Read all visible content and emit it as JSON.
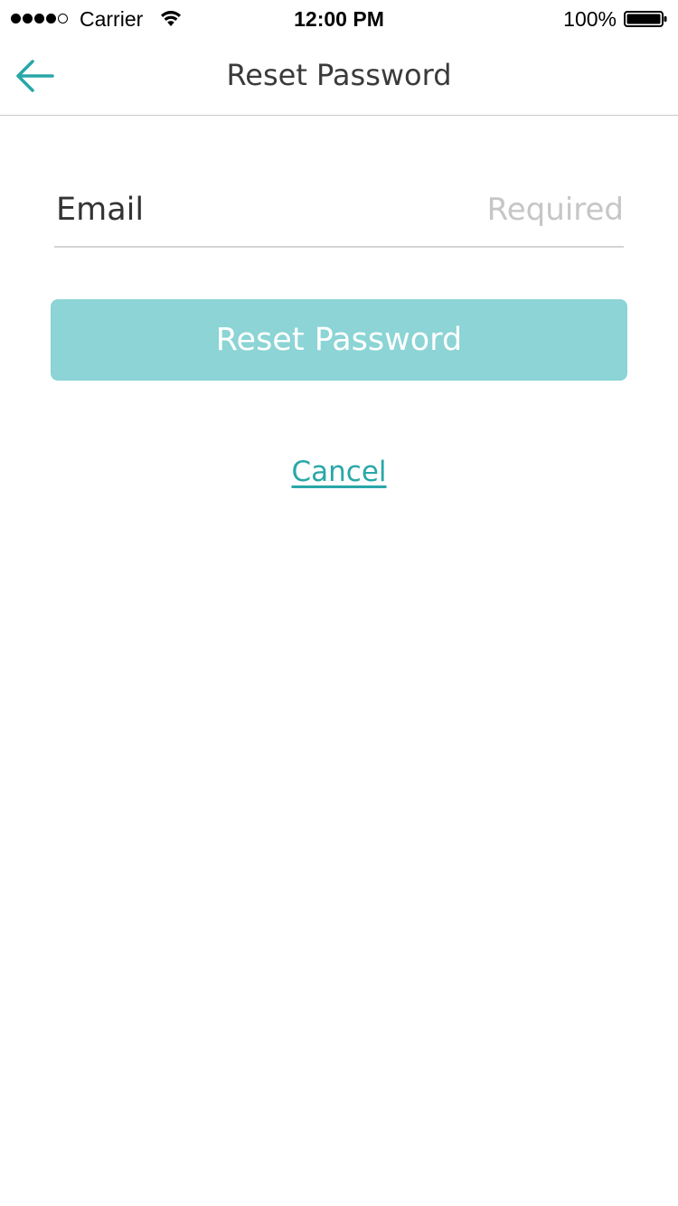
{
  "status_bar": {
    "signal_bars_filled": 4,
    "signal_bars_total": 5,
    "carrier": "Carrier",
    "time": "12:00 PM",
    "battery_percent": "100%",
    "wifi_icon": "wifi-icon",
    "battery_icon": "battery-icon"
  },
  "nav": {
    "back_icon": "arrow-left-icon",
    "title": "Reset Password"
  },
  "form": {
    "email_label": "Email",
    "email_value": "",
    "email_placeholder": "Required",
    "submit_label": "Reset Password",
    "cancel_label": "Cancel"
  },
  "colors": {
    "accent": "#2aa7a8",
    "button_bg": "#8cd4d5",
    "title_text": "#3a3a3a",
    "placeholder": "#c6c6c6"
  }
}
